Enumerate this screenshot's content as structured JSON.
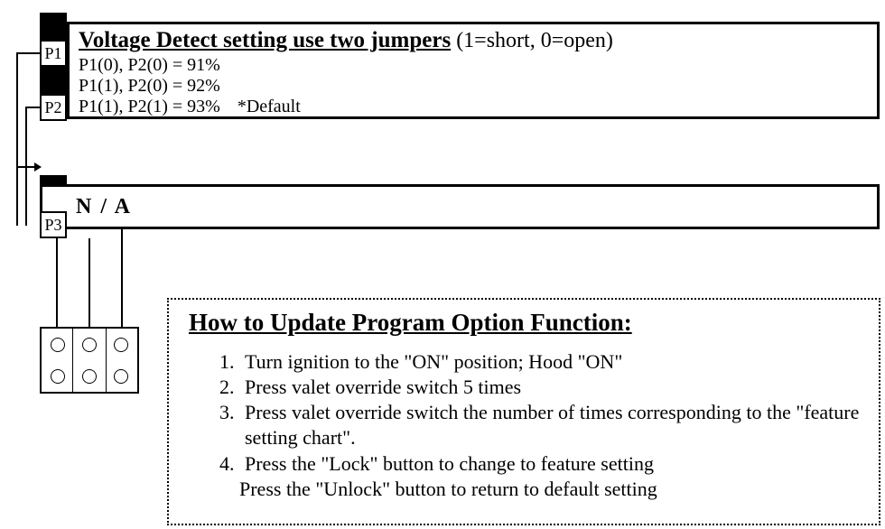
{
  "voltageBox": {
    "title": "Voltage Detect setting use two jumpers",
    "suffix": " (1=short, 0=open)",
    "lines": [
      "P1(0), P2(0) = 91%",
      "P1(1), P2(0) = 92%",
      "P1(1), P2(1) = 93%"
    ],
    "defaultNote": "*Default"
  },
  "jumperLabels": {
    "p1": "P1",
    "p2": "P2",
    "p3": "P3"
  },
  "naBox": {
    "text": "N / A"
  },
  "instructions": {
    "title": "How to Update Program Option Function:",
    "steps": [
      "Turn ignition to the \"ON\" position; Hood \"ON\"",
      "Press valet override switch 5 times",
      "Press valet override switch the number of times corresponding to the \"feature setting chart\".",
      "Press the \"Lock\" button to change to feature setting"
    ],
    "extraLine": "Press the \"Unlock\" button to return to default setting"
  }
}
